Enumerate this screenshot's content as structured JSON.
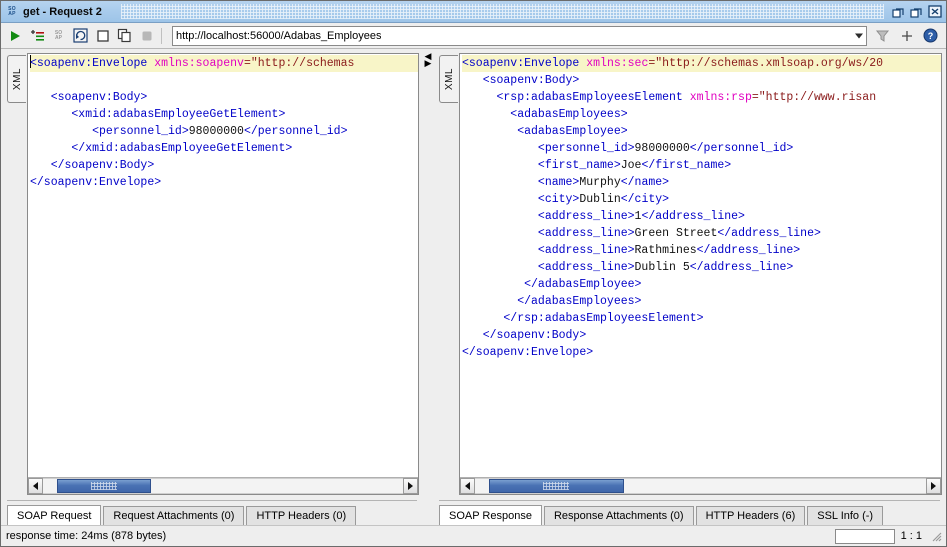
{
  "window": {
    "title": "get - Request 2",
    "app_icon": "soap-icon",
    "buttons": [
      {
        "name": "restore-down-button",
        "icon": "restore-icon"
      },
      {
        "name": "maximize-button",
        "icon": "maximize-icon"
      },
      {
        "name": "close-button",
        "icon": "close-icon"
      }
    ]
  },
  "toolbar": {
    "icons": [
      {
        "name": "submit-request-button",
        "icon": "play-icon",
        "title": "Submit request"
      },
      {
        "name": "add-to-testcase-button",
        "icon": "add-list-icon",
        "title": "Add to TestCase"
      },
      {
        "name": "create-empty-request-button",
        "icon": "soap-icon",
        "title": "Create empty request"
      },
      {
        "name": "ws-a-options-button",
        "icon": "refresh-box-icon",
        "title": "WS-A options"
      },
      {
        "name": "one-way-button",
        "icon": "square-icon",
        "title": "One-Way"
      },
      {
        "name": "clone-request-button",
        "icon": "copy-icon",
        "title": "Clone request"
      },
      {
        "name": "cancel-button",
        "icon": "stop-icon",
        "title": "Cancel"
      }
    ],
    "url": "http://localhost:56000/Adabas_Employees",
    "url_placeholder": "Endpoint URL",
    "right_icons": [
      {
        "name": "filter-button",
        "icon": "filter-icon"
      },
      {
        "name": "add-endpoint-button",
        "icon": "plus-icon"
      },
      {
        "name": "help-button",
        "icon": "help-icon"
      }
    ]
  },
  "request_pane": {
    "vertical_tab": "XML",
    "lines": [
      {
        "highlight": true,
        "caret": true,
        "segments": [
          {
            "text": "<soapenv:Envelope ",
            "cls": "tagc"
          },
          {
            "text": "xmlns:soapenv",
            "cls": "attrc"
          },
          {
            "text": "=\"http://schemas",
            "cls": "valc"
          }
        ]
      },
      {
        "segments": []
      },
      {
        "segments": [
          {
            "text": "   <soapenv:Body>",
            "cls": "tagc"
          }
        ]
      },
      {
        "segments": [
          {
            "text": "      <xmid:adabasEmployeeGetElement>",
            "cls": "tagc"
          }
        ]
      },
      {
        "segments": [
          {
            "text": "         <personnel_id>",
            "cls": "tagc"
          },
          {
            "text": "98000000",
            "cls": "textc"
          },
          {
            "text": "</personnel_id>",
            "cls": "tagc"
          }
        ]
      },
      {
        "segments": [
          {
            "text": "      </xmid:adabasEmployeeGetElement>",
            "cls": "tagc"
          }
        ]
      },
      {
        "segments": [
          {
            "text": "   </soapenv:Body>",
            "cls": "tagc"
          }
        ]
      },
      {
        "segments": [
          {
            "text": "</soapenv:Envelope>",
            "cls": "tagc"
          }
        ]
      }
    ],
    "scrollbar": {
      "thumb_left_pct": 4,
      "thumb_width_pct": 26
    },
    "tabs": [
      {
        "label": "SOAP Request",
        "active": true,
        "name": "tab-soap-request"
      },
      {
        "label": "Request Attachments (0)",
        "active": false,
        "name": "tab-request-attachments"
      },
      {
        "label": "HTTP Headers (0)",
        "active": false,
        "name": "tab-request-http-headers"
      }
    ]
  },
  "response_pane": {
    "vertical_tab": "XML",
    "lines": [
      {
        "highlight": true,
        "segments": [
          {
            "text": "<soapenv:Envelope ",
            "cls": "tagc"
          },
          {
            "text": "xmlns:sec",
            "cls": "attrc"
          },
          {
            "text": "=\"http://schemas.xmlsoap.org/ws/20",
            "cls": "valc"
          }
        ]
      },
      {
        "segments": [
          {
            "text": "   <soapenv:Body>",
            "cls": "tagc"
          }
        ]
      },
      {
        "segments": [
          {
            "text": "     <rsp:adabasEmployeesElement ",
            "cls": "tagc"
          },
          {
            "text": "xmlns:rsp",
            "cls": "attrc"
          },
          {
            "text": "=\"http://www.risan",
            "cls": "valc"
          }
        ]
      },
      {
        "segments": [
          {
            "text": "       <adabasEmployees>",
            "cls": "tagc"
          }
        ]
      },
      {
        "segments": [
          {
            "text": "        <adabasEmployee>",
            "cls": "tagc"
          }
        ]
      },
      {
        "segments": [
          {
            "text": "           <personnel_id>",
            "cls": "tagc"
          },
          {
            "text": "98000000",
            "cls": "textc"
          },
          {
            "text": "</personnel_id>",
            "cls": "tagc"
          }
        ]
      },
      {
        "segments": [
          {
            "text": "           <first_name>",
            "cls": "tagc"
          },
          {
            "text": "Joe",
            "cls": "textc"
          },
          {
            "text": "</first_name>",
            "cls": "tagc"
          }
        ]
      },
      {
        "segments": [
          {
            "text": "           <name>",
            "cls": "tagc"
          },
          {
            "text": "Murphy",
            "cls": "textc"
          },
          {
            "text": "</name>",
            "cls": "tagc"
          }
        ]
      },
      {
        "segments": [
          {
            "text": "           <city>",
            "cls": "tagc"
          },
          {
            "text": "Dublin",
            "cls": "textc"
          },
          {
            "text": "</city>",
            "cls": "tagc"
          }
        ]
      },
      {
        "segments": [
          {
            "text": "           <address_line>",
            "cls": "tagc"
          },
          {
            "text": "1",
            "cls": "textc"
          },
          {
            "text": "</address_line>",
            "cls": "tagc"
          }
        ]
      },
      {
        "segments": [
          {
            "text": "           <address_line>",
            "cls": "tagc"
          },
          {
            "text": "Green Street",
            "cls": "textc"
          },
          {
            "text": "</address_line>",
            "cls": "tagc"
          }
        ]
      },
      {
        "segments": [
          {
            "text": "           <address_line>",
            "cls": "tagc"
          },
          {
            "text": "Rathmines",
            "cls": "textc"
          },
          {
            "text": "</address_line>",
            "cls": "tagc"
          }
        ]
      },
      {
        "segments": [
          {
            "text": "           <address_line>",
            "cls": "tagc"
          },
          {
            "text": "Dublin 5",
            "cls": "textc"
          },
          {
            "text": "</address_line>",
            "cls": "tagc"
          }
        ]
      },
      {
        "segments": [
          {
            "text": "         </adabasEmployee>",
            "cls": "tagc"
          }
        ]
      },
      {
        "segments": [
          {
            "text": "        </adabasEmployees>",
            "cls": "tagc"
          }
        ]
      },
      {
        "segments": [
          {
            "text": "      </rsp:adabasEmployeesElement>",
            "cls": "tagc"
          }
        ]
      },
      {
        "segments": [
          {
            "text": "   </soapenv:Body>",
            "cls": "tagc"
          }
        ]
      },
      {
        "segments": [
          {
            "text": "</soapenv:Envelope>",
            "cls": "tagc"
          }
        ]
      }
    ],
    "scrollbar": {
      "thumb_left_pct": 3,
      "thumb_width_pct": 30
    },
    "tabs": [
      {
        "label": "SOAP Response",
        "active": true,
        "name": "tab-soap-response"
      },
      {
        "label": "Response Attachments (0)",
        "active": false,
        "name": "tab-response-attachments"
      },
      {
        "label": "HTTP Headers (6)",
        "active": false,
        "name": "tab-response-http-headers"
      },
      {
        "label": "SSL Info (-)",
        "active": false,
        "name": "tab-ssl-info"
      }
    ]
  },
  "statusbar": {
    "text": "response time: 24ms (878 bytes)",
    "field_value": "",
    "position": "1 : 1"
  },
  "colors": {
    "title_bar": "#a8cbec",
    "tag": "#0000c8",
    "attribute": "#e000c0",
    "value": "#8a1a1a",
    "highlight_line": "#f8f5c8",
    "scroll_thumb": "#4a72b4",
    "play_icon": "#118811"
  }
}
